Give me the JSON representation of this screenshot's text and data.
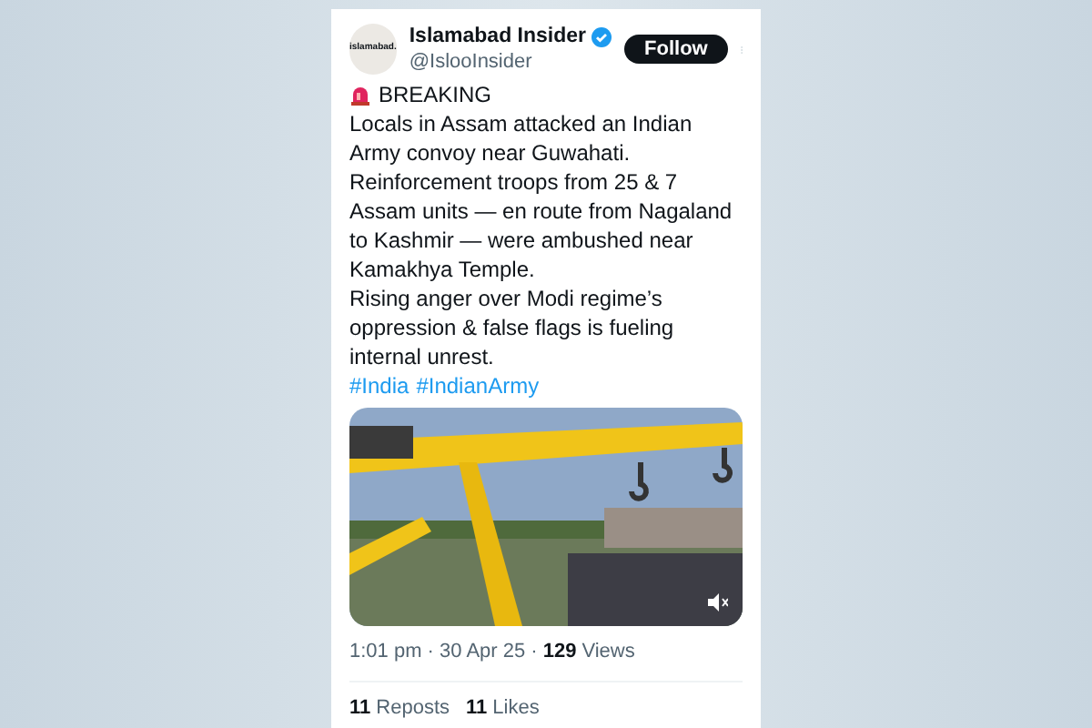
{
  "account": {
    "avatar_text": "islamabad.",
    "name": "Islamabad Insider",
    "verified": true,
    "handle": "@IslooInsider"
  },
  "follow_button": "Follow",
  "post": {
    "heading": "BREAKING",
    "paragraphs": [
      "Locals in Assam attacked an Indian Army convoy near Guwahati.",
      "Reinforcement troops from 25 & 7 Assam units — en route from Nagaland to Kashmir — were ambushed near Kamakhya Temple.",
      "Rising anger over Modi regime’s oppression & false flags is fueling internal unrest."
    ],
    "hashtags": [
      "#India",
      "#IndianArmy"
    ]
  },
  "meta": {
    "time": "1:01 pm · 30 Apr 25 · ",
    "views_count": "129",
    "views_label": "Views"
  },
  "stats": [
    {
      "count": "11",
      "label": "Reposts"
    },
    {
      "count": "11",
      "label": "Likes"
    }
  ]
}
